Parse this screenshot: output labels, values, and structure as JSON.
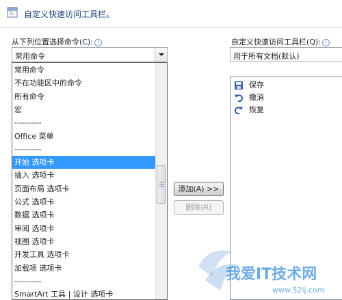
{
  "dialog": {
    "title": "自定义快速访问工具栏。"
  },
  "left": {
    "choose_label": "从下列位置选择命令(C):",
    "combo_value": "常用命令",
    "dropdown_options": [
      "常用命令",
      "不在功能区中的命令",
      "所有命令",
      "宏",
      "----------",
      "Office 菜单",
      "----------",
      "开始 选项卡",
      "插入 选项卡",
      "页面布局 选项卡",
      "公式 选项卡",
      "数据 选项卡",
      "审阅 选项卡",
      "视图 选项卡",
      "开发工具 选项卡",
      "加载项 选项卡",
      "----------",
      "SmartArt 工具 | 设计 选项卡"
    ],
    "selected_option": "开始 选项卡"
  },
  "right": {
    "customize_label": "自定义快速访问工具栏(Q):",
    "combo_value": "用于所有文档(默认)",
    "items": [
      {
        "label": "保存",
        "icon": "save-icon"
      },
      {
        "label": "撤消",
        "icon": "undo-icon"
      },
      {
        "label": "恢复",
        "icon": "redo-icon"
      }
    ]
  },
  "buttons": {
    "add_label": "添加(A) >>",
    "remove_label": "删除(R)"
  },
  "watermark": {
    "text": "我爱IT技术网",
    "url": "www.52ij.com"
  },
  "colors": {
    "selection": "#3399ff",
    "title": "#1e3f7a"
  }
}
